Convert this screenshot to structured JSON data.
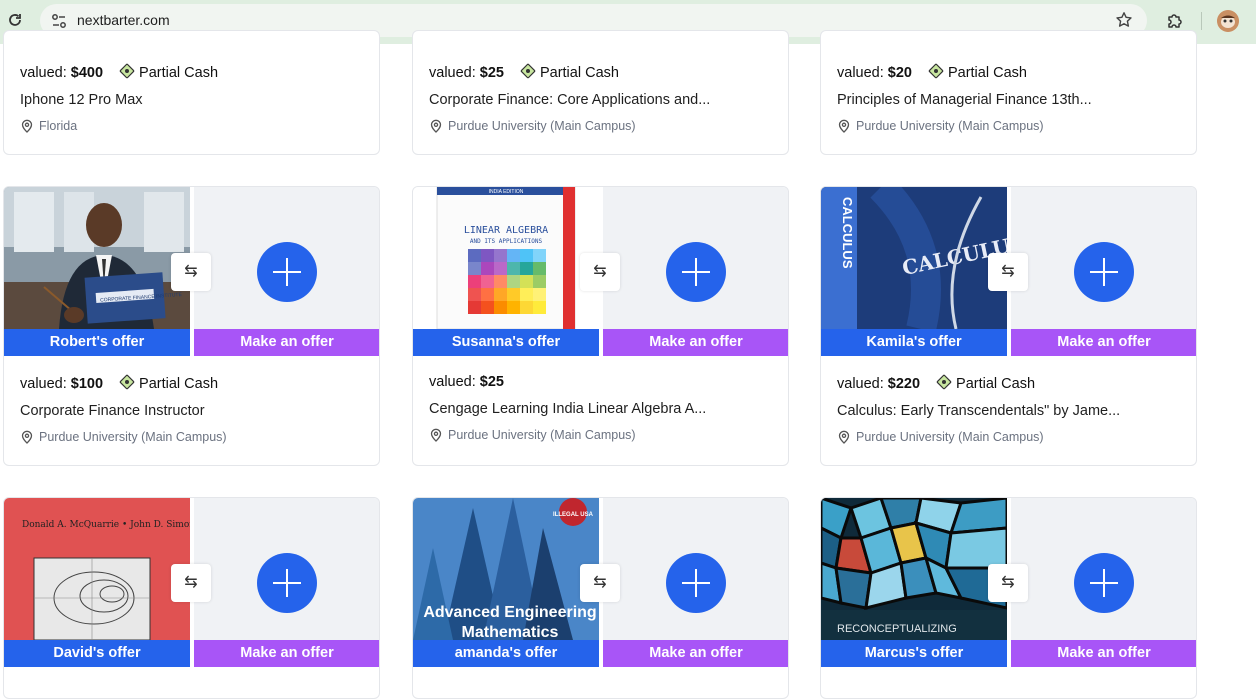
{
  "browser": {
    "url": "nextbarter.com"
  },
  "common": {
    "make_offer_label": "Make an offer",
    "swap_glyph": "⇆",
    "partial_cash_label": "Partial Cash",
    "valued_label": "valued:"
  },
  "top_row": [
    {
      "price": "$400",
      "title": "Iphone 12 Pro Max",
      "location": "Florida",
      "partial_cash": true
    },
    {
      "price": "$25",
      "title": "Corporate Finance: Core Applications and...",
      "location": "Purdue University (Main Campus)",
      "partial_cash": true
    },
    {
      "price": "$20",
      "title": "Principles of Managerial Finance 13th...",
      "location": "Purdue University (Main Campus)",
      "partial_cash": true
    }
  ],
  "middle_row": [
    {
      "offer_owner": "Robert's offer",
      "price": "$100",
      "title": "Corporate Finance Instructor",
      "location": "Purdue University (Main Campus)",
      "partial_cash": true,
      "image": {
        "kind": "photo",
        "book_text": "CORPORATE FINANCE INSTITUTE"
      }
    },
    {
      "offer_owner": "Susanna's offer",
      "price": "$25",
      "title": "Cengage Learning India Linear Algebra A...",
      "location": "Purdue University (Main Campus)",
      "partial_cash": false,
      "image": {
        "kind": "book",
        "edition": "INDIA EDITION",
        "line1": "LINEAR ALGEBRA",
        "line2": "AND ITS APPLICATIONS"
      }
    },
    {
      "offer_owner": "Kamila's offer",
      "price": "$220",
      "title": "Calculus: Early Transcendentals\" by Jame...",
      "location": "Purdue University (Main Campus)",
      "partial_cash": true,
      "image": {
        "kind": "book",
        "spine": "CALCULUS",
        "cover": "CALCULUS"
      }
    }
  ],
  "bottom_row": [
    {
      "offer_owner": "David's offer",
      "image": {
        "kind": "book",
        "authors": "Donald A. McQuarrie • John D. Simon"
      }
    },
    {
      "offer_owner": "amanda's offer",
      "image": {
        "kind": "book",
        "line1": "Advanced Engineering",
        "line2": "Mathematics",
        "badge": "ILLEGAL USA"
      }
    },
    {
      "offer_owner": "Marcus's offer",
      "image": {
        "kind": "book",
        "line1": "RECONCEPTUALIZING"
      }
    }
  ],
  "colors": {
    "offer_blue": "#2563eb",
    "offer_purple": "#a855f7",
    "plus_blue": "#2563eb"
  }
}
